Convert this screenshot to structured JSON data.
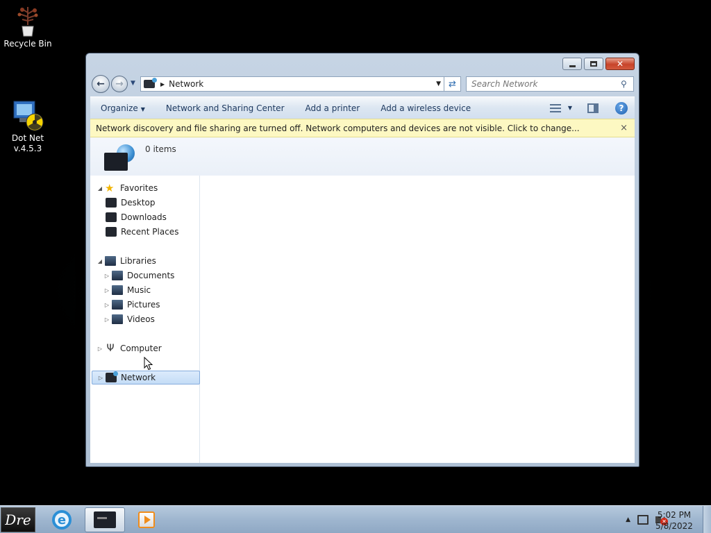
{
  "desktop": {
    "icons": [
      {
        "label": "Recycle Bin",
        "icon": "recycle-bin-icon"
      },
      {
        "label": "Dot Net\nv.4.5.3",
        "icon": "dotnet-installer-icon"
      }
    ]
  },
  "window": {
    "address": {
      "crumb": "Network",
      "icon": "network-icon"
    },
    "search": {
      "placeholder": "Search Network"
    },
    "toolbar": {
      "organize": "Organize",
      "network_sharing": "Network and Sharing Center",
      "add_printer": "Add a printer",
      "add_wireless": "Add a wireless device"
    },
    "infobar": {
      "message": "Network discovery and file sharing are turned off. Network computers and devices are not visible. Click to change...",
      "close": "×"
    },
    "header": {
      "item_count": "0 items"
    },
    "nav": {
      "favorites": {
        "label": "Favorites",
        "items": [
          "Desktop",
          "Downloads",
          "Recent Places"
        ]
      },
      "libraries": {
        "label": "Libraries",
        "items": [
          "Documents",
          "Music",
          "Pictures",
          "Videos"
        ]
      },
      "computer": "Computer",
      "network": "Network"
    }
  },
  "taskbar": {
    "start_label": "Dre",
    "clock": {
      "time": "5:02 PM",
      "date": "5/8/2022"
    }
  },
  "colors": {
    "infobar": "#fdf8c2",
    "selection": "#c4dcf6",
    "taskbar": "#9fb6cf"
  }
}
